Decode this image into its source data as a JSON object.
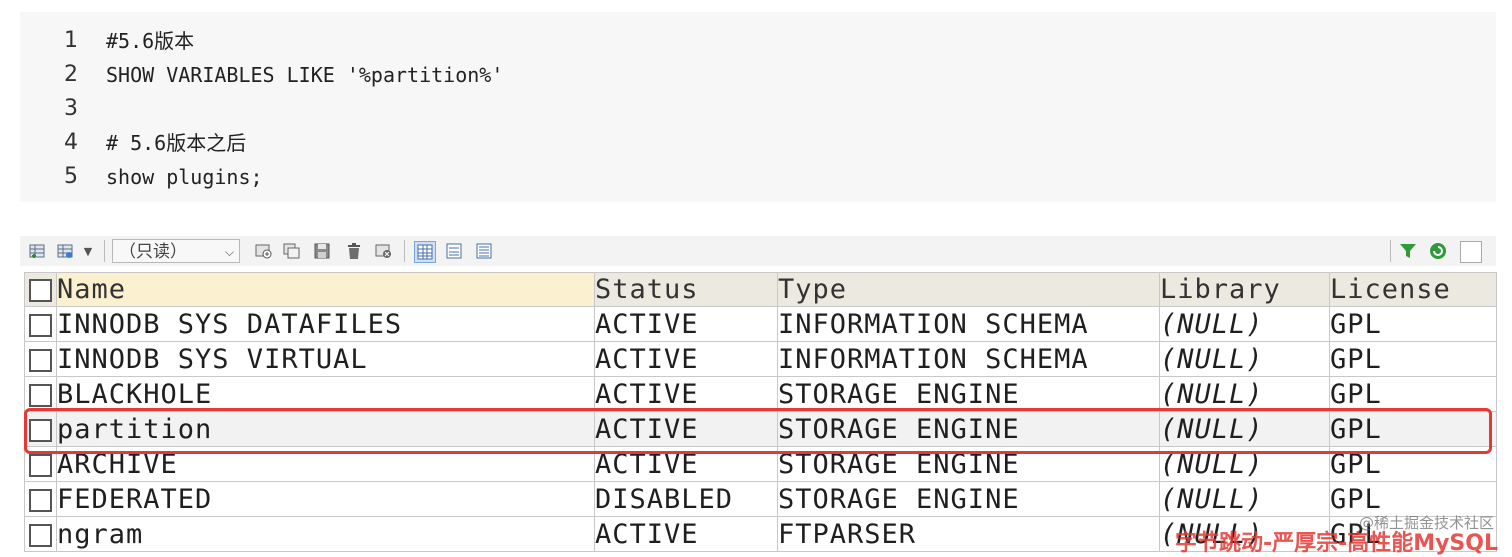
{
  "code": {
    "lines": [
      {
        "num": "1",
        "text": "#5.6版本"
      },
      {
        "num": "2",
        "text": "SHOW VARIABLES LIKE '%partition%'"
      },
      {
        "num": "3",
        "text": ""
      },
      {
        "num": "4",
        "text": "# 5.6版本之后"
      },
      {
        "num": "5",
        "text": "show plugins;"
      }
    ]
  },
  "toolbar": {
    "readonly_label": "（只读）"
  },
  "table": {
    "headers": [
      "Name",
      "Status",
      "Type",
      "Library",
      "License"
    ],
    "rows": [
      {
        "name": "INNODB SYS DATAFILES",
        "status": "ACTIVE",
        "type": "INFORMATION SCHEMA",
        "library": "(NULL)",
        "license": "GPL"
      },
      {
        "name": "INNODB SYS VIRTUAL",
        "status": "ACTIVE",
        "type": "INFORMATION SCHEMA",
        "library": "(NULL)",
        "license": "GPL"
      },
      {
        "name": "BLACKHOLE",
        "status": "ACTIVE",
        "type": "STORAGE ENGINE",
        "library": "(NULL)",
        "license": "GPL"
      },
      {
        "name": "partition",
        "status": "ACTIVE",
        "type": "STORAGE ENGINE",
        "library": "(NULL)",
        "license": "GPL"
      },
      {
        "name": "ARCHIVE",
        "status": "ACTIVE",
        "type": "STORAGE ENGINE",
        "library": "(NULL)",
        "license": "GPL"
      },
      {
        "name": "FEDERATED",
        "status": "DISABLED",
        "type": "STORAGE ENGINE",
        "library": "(NULL)",
        "license": "GPL"
      },
      {
        "name": "ngram",
        "status": "ACTIVE",
        "type": "FTPARSER",
        "library": "(NULL)",
        "license": "GPL"
      }
    ]
  },
  "watermark": {
    "text": "字节跳动-严厚宗-高性能MySQL",
    "source": "@稀土掘金技术社区"
  },
  "colors": {
    "highlight_border": "#e53935",
    "header_bg": "#eceae0",
    "name_header_bg": "#fbf0cf"
  }
}
